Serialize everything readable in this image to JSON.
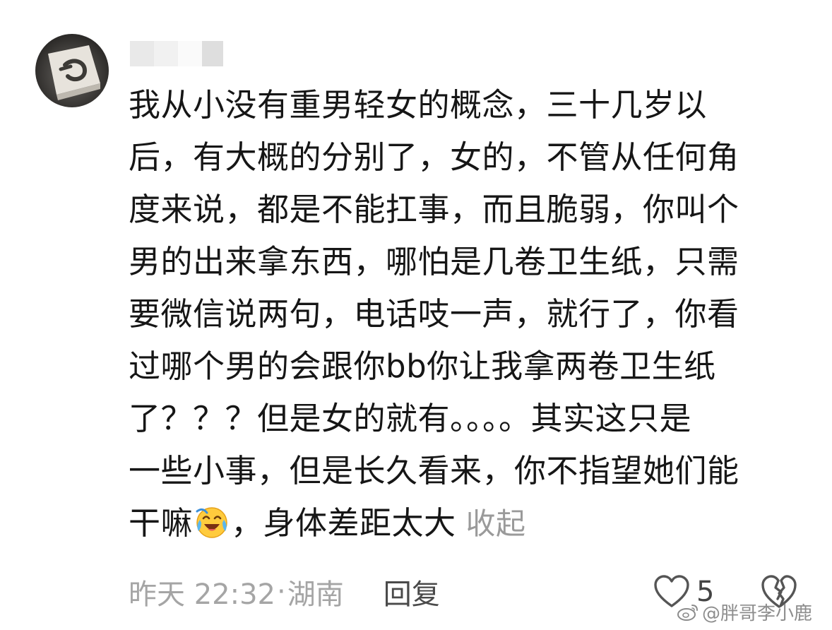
{
  "comment": {
    "lines": [
      "我从小没有重男轻女的概念，三十几岁以",
      "后，有大概的分别了，女的，不管从任何角",
      "度来说，都是不能扛事，而且脆弱，你叫个",
      "男的出来拿东西，哪怕是几卷卫生纸，只需",
      "要微信说两句，电话吱一声，就行了，你看",
      "过哪个男的会跟你bb你让我拿两卷卫生纸",
      "了？？？但是女的就有。。。。其实这只是",
      "一些小事，但是长久看来，你不指望她们能"
    ],
    "last_line_before_emoji": "干嘛",
    "last_line_after_emoji": "，身体差距太大",
    "emoji_icon": "laughing-crying-emoji-icon",
    "collapse_label": "收起"
  },
  "footer": {
    "time": "昨天 22:32",
    "separator": "·",
    "location": "湖南",
    "reply_label": "回复"
  },
  "actions": {
    "like_count": "5",
    "like_icon": "heart-outline-icon",
    "dislike_icon": "broken-heart-icon"
  },
  "watermark": {
    "text": "@胖哥李小鹿",
    "icon": "weibo-logo-icon"
  },
  "colors": {
    "text": "#161616",
    "muted": "#a5a5a5",
    "reply": "#4a4a4a"
  }
}
